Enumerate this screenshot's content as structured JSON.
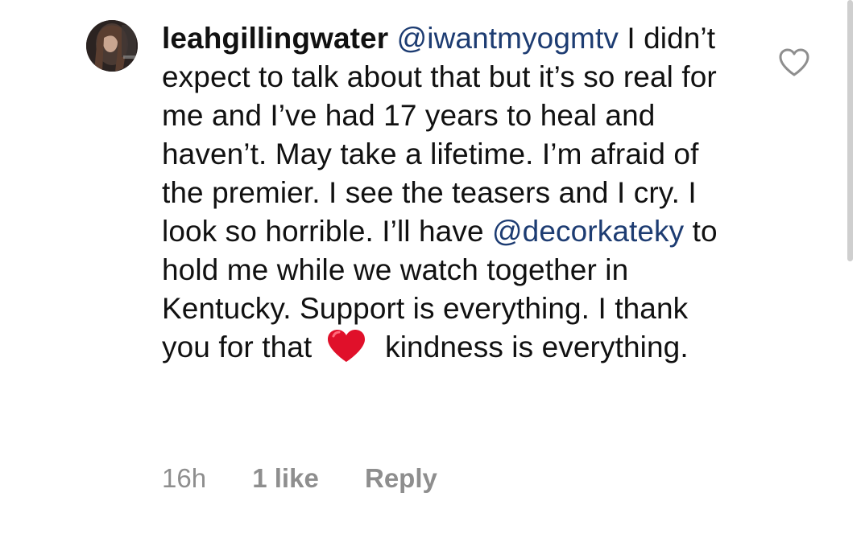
{
  "comment": {
    "username": "leahgillingwater",
    "mention_1": "@iwantmyogmtv",
    "text_1": " I didn’t expect to talk about that but it’s so real for me and I’ve had 17 years to heal and haven’t. May take a lifetime. I’m afraid of the premier. I see the teasers and I cry. I look so horrible. I’ll have ",
    "mention_2": "@decorkateky",
    "text_2": " to hold me while we watch together in Kentucky. Support is everything. I thank you for that",
    "text_3": "kindness is everything.",
    "emoji": "red-heart-emoji",
    "time": "16h",
    "likes": "1 like",
    "reply_label": "Reply"
  },
  "icons": {
    "like": "heart-outline-icon",
    "avatar": "profile-avatar"
  },
  "colors": {
    "mention": "#1d3c72",
    "meta": "#8e8e8e",
    "heart_emoji": "#e0102a"
  }
}
